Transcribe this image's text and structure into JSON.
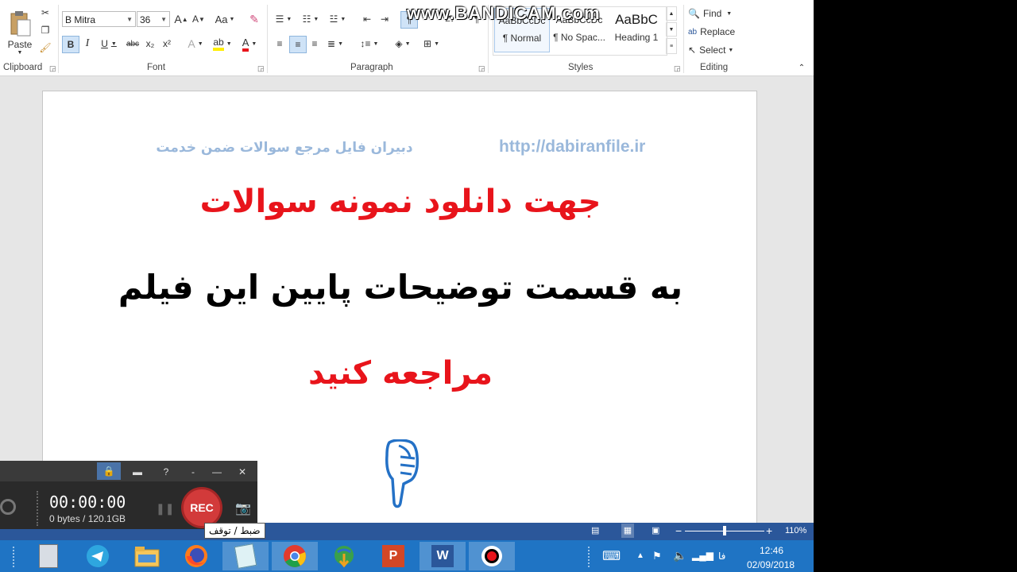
{
  "ribbon": {
    "clipboard": {
      "label": "Clipboard",
      "paste_label": "Paste"
    },
    "font": {
      "label": "Font",
      "font_name": "B Mitra",
      "font_size": "36",
      "case_label": "Aa",
      "bold": "B",
      "italic": "I",
      "underline": "U",
      "strike": "abc",
      "subscript": "x₂",
      "superscript": "x²",
      "grow": "A",
      "shrink": "A"
    },
    "paragraph": {
      "label": "Paragraph"
    },
    "styles": {
      "label": "Styles",
      "items": [
        {
          "sample": "AaBbCcDc",
          "name": "¶ Normal"
        },
        {
          "sample": "AaBbCcDc",
          "name": "¶ No Spac..."
        },
        {
          "sample": "AaBbC",
          "name": "Heading 1"
        }
      ]
    },
    "editing": {
      "label": "Editing",
      "find": "Find",
      "replace": "Replace",
      "select": "Select"
    }
  },
  "watermark": "www.BANDICAM.com",
  "document": {
    "header_left": "دبیران فایل مرجع سوالات ضمن خدمت",
    "header_right": "http://dabiranfile.ir",
    "line1": "جهت دانلود نمونه سوالات",
    "line2": "به قسمت توضیحات پایین این فیلم",
    "line3": "مراجعه کنید",
    "colors": {
      "red": "#e8141b",
      "header": "#9ab8db",
      "black": "#000000",
      "hand": "#2471c6"
    }
  },
  "status": {
    "zoom": "110%"
  },
  "bandicam": {
    "timer": "00:00:00",
    "size": "0 bytes / 120.1GB",
    "rec": "REC",
    "tooltip": "ضبط / توقف"
  },
  "taskbar": {
    "lang": "فا",
    "time": "12:46",
    "date": "02/09/2018"
  }
}
